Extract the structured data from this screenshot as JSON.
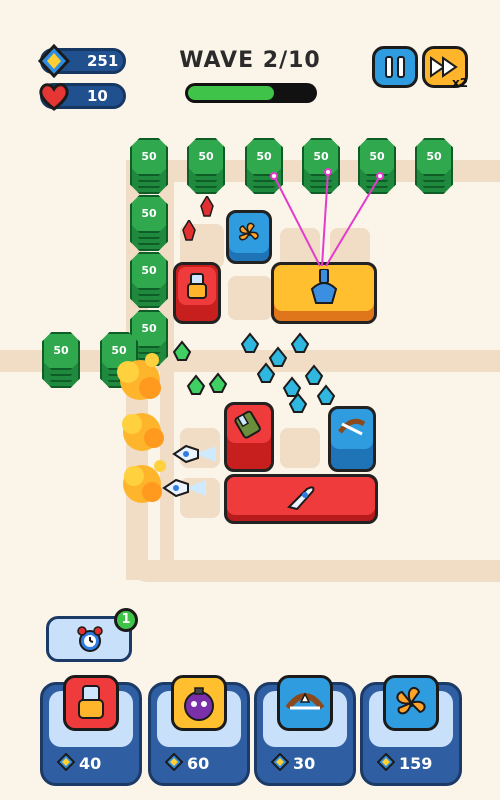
{
  "hud": {
    "gems": "251",
    "lives": "10",
    "wave_label": "WAVE 2/10",
    "wave_progress": 0.68,
    "speed_label": "x2"
  },
  "coin_stacks": [
    "50",
    "50",
    "50",
    "50",
    "50",
    "50",
    "50",
    "50",
    "50",
    "50",
    "50",
    "50"
  ],
  "powerup": {
    "badge_count": "1",
    "icon": "alarm-clock-icon"
  },
  "shop": [
    {
      "icon": "cannon-icon",
      "price": "40",
      "color": "#ef3b3b"
    },
    {
      "icon": "bomb-icon",
      "price": "60",
      "color": "#ffbf2e"
    },
    {
      "icon": "crossbow-icon",
      "price": "30",
      "color": "#2f9ce0"
    },
    {
      "icon": "fan-icon",
      "price": "159",
      "color": "#2f9ce0"
    }
  ],
  "colors": {
    "background": "#fbf4e9",
    "path": "#f1dcc6",
    "coin_green": "#1f8a3d",
    "red": "#ef3b3b",
    "blue": "#2f9ce0",
    "orange": "#ffbf2e",
    "hud_blue": "#21508f"
  }
}
